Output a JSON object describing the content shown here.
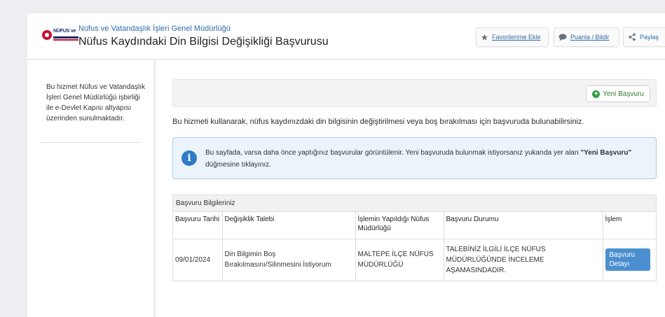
{
  "header": {
    "org": "Nüfus ve Vatandaşlık İşleri Genel Müdürlüğü",
    "title": "Nüfus Kaydındaki Din Bilgisi Değişikliği Başvurusu",
    "logo_text": "NÜFUS ve",
    "buttons": {
      "favorite": "Favorilerime Ekle",
      "rate": "Puanla / Bildir",
      "share": "Paylaş"
    }
  },
  "sidebar": {
    "text": "Bu hizmet Nüfus ve Vatandaşlık İşleri Genel Müdürlüğü işbirliği ile e-Devlet Kapısı altyapısı üzerinden sunulmaktadır."
  },
  "main": {
    "new_application": "Yeni Başvuru",
    "description": "Bu hizmeti kullanarak, nüfus kaydınızdaki din bilgisinin değiştirilmesi veya boş bırakılması için başvuruda bulunabilirsiniz.",
    "info": {
      "text_before": "Bu sayfada, varsa daha önce yaptığınız başvurular görüntülenir. Yeni başvuruda bulunmak istiyorsanız yukarıda yer alan ",
      "text_bold": "\"Yeni Başvuru\"",
      "text_after": " düğmesine tıklayınız."
    },
    "table": {
      "caption": "Başvuru Bilgileriniz",
      "headers": [
        "Başvuru Tarihi",
        "Değişiklik Talebi",
        "İşlemin Yapıldığı Nüfus Müdürlüğü",
        "Başvuru Durumu",
        "İşlem"
      ],
      "rows": [
        {
          "date": "09/01/2024",
          "request": "Din Bilgimin Boş Bırakılmasını/Silinmesini İstiyorum",
          "office": "MALTEPE İLÇE NÜFUS MÜDÜRLÜĞÜ",
          "status": "TALEBİNİZ İLGİLİ İLÇE NÜFUS MÜDÜRLÜĞÜNDE İNCELEME AŞAMASINDADIR.",
          "action": "Başvuru Detayı"
        }
      ]
    }
  },
  "colors": {
    "link": "#2f6aa8",
    "success": "#2e9e45",
    "info_bg": "#ebf3fb",
    "info_border": "#aecbe6",
    "action_button": "#4c8fd0"
  },
  "icons": [
    "star-icon",
    "speech-bubble-icon",
    "share-icon",
    "plus-circle-icon",
    "info-icon"
  ]
}
